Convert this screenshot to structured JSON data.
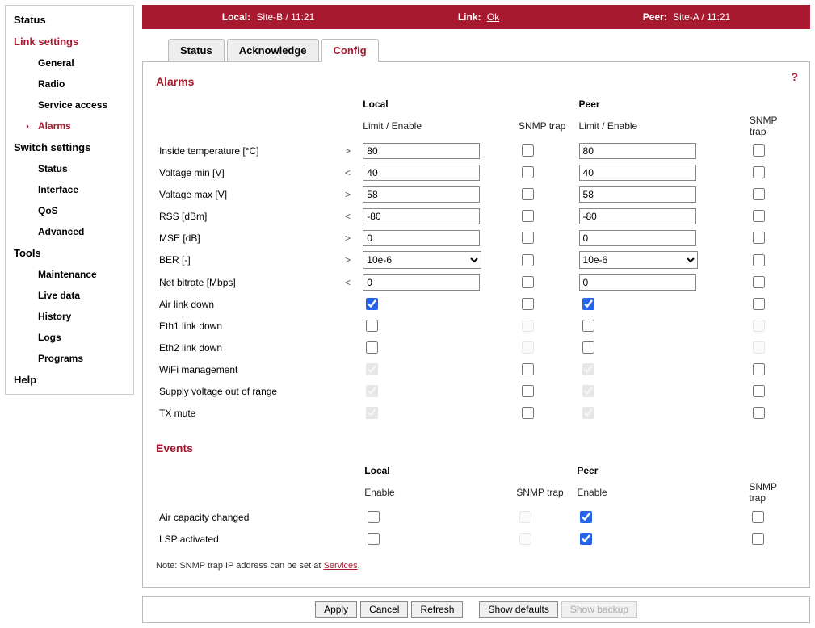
{
  "nav": {
    "sections": [
      {
        "label": "Status",
        "items": []
      },
      {
        "label": "Link settings",
        "active": true,
        "items": [
          {
            "label": "General"
          },
          {
            "label": "Radio"
          },
          {
            "label": "Service access"
          },
          {
            "label": "Alarms",
            "selected": true
          }
        ]
      },
      {
        "label": "Switch settings",
        "items": [
          {
            "label": "Status"
          },
          {
            "label": "Interface"
          },
          {
            "label": "QoS"
          },
          {
            "label": "Advanced"
          }
        ]
      },
      {
        "label": "Tools",
        "items": [
          {
            "label": "Maintenance"
          },
          {
            "label": "Live data"
          },
          {
            "label": "History"
          },
          {
            "label": "Logs"
          },
          {
            "label": "Programs"
          }
        ]
      },
      {
        "label": "Help",
        "items": []
      }
    ]
  },
  "topbar": {
    "localLabel": "Local:",
    "localValue": "Site-B / 11:21",
    "linkLabel": "Link:",
    "linkValue": "Ok",
    "peerLabel": "Peer:",
    "peerValue": "Site-A / 11:21"
  },
  "tabs": [
    {
      "label": "Status"
    },
    {
      "label": "Acknowledge"
    },
    {
      "label": "Config",
      "selected": true
    }
  ],
  "alarms": {
    "title": "Alarms",
    "headers": {
      "local": "Local",
      "peer": "Peer",
      "limitEnable": "Limit / Enable",
      "snmp": "SNMP trap"
    },
    "rows": [
      {
        "label": "Inside temperature [°C]",
        "op": ">",
        "type": "text",
        "local": "80",
        "peer": "80",
        "enL": false,
        "enP": false,
        "snL": false,
        "snP": false
      },
      {
        "label": "Voltage min [V]",
        "op": "<",
        "type": "text",
        "local": "40",
        "peer": "40",
        "enL": false,
        "enP": false,
        "snL": false,
        "snP": false
      },
      {
        "label": "Voltage max [V]",
        "op": ">",
        "type": "text",
        "local": "58",
        "peer": "58",
        "enL": false,
        "enP": false,
        "snL": false,
        "snP": false
      },
      {
        "label": "RSS [dBm]",
        "op": "<",
        "type": "text",
        "local": "-80",
        "peer": "-80",
        "enL": false,
        "enP": false,
        "snL": false,
        "snP": false
      },
      {
        "label": "MSE [dB]",
        "op": ">",
        "type": "text",
        "local": "0",
        "peer": "0",
        "enL": false,
        "enP": false,
        "snL": false,
        "snP": false
      },
      {
        "label": "BER [-]",
        "op": ">",
        "type": "select",
        "local": "10e-6",
        "peer": "10e-6",
        "enL": false,
        "enP": false,
        "snL": false,
        "snP": false
      },
      {
        "label": "Net bitrate [Mbps]",
        "op": "<",
        "type": "text",
        "local": "0",
        "peer": "0",
        "enL": false,
        "enP": false,
        "snL": false,
        "snP": false
      },
      {
        "label": "Air link down",
        "op": "",
        "type": "check",
        "enL": true,
        "enP": true,
        "snL": false,
        "snP": false
      },
      {
        "label": "Eth1 link down",
        "op": "",
        "type": "check",
        "enL": false,
        "enP": false,
        "snL": false,
        "snP": false,
        "snLdis": true,
        "snPdis": true
      },
      {
        "label": "Eth2 link down",
        "op": "",
        "type": "check",
        "enL": false,
        "enP": false,
        "snL": false,
        "snP": false,
        "snLdis": true,
        "snPdis": true
      },
      {
        "label": "WiFi management",
        "op": "",
        "type": "check",
        "enL": true,
        "enP": true,
        "enLdis": true,
        "enPdis": true,
        "snL": false,
        "snP": false
      },
      {
        "label": "Supply voltage out of range",
        "op": "",
        "type": "check",
        "enL": true,
        "enP": true,
        "enLdis": true,
        "enPdis": true,
        "snL": false,
        "snP": false
      },
      {
        "label": "TX mute",
        "op": "",
        "type": "check",
        "enL": true,
        "enP": true,
        "enLdis": true,
        "enPdis": true,
        "snL": false,
        "snP": false
      }
    ]
  },
  "events": {
    "title": "Events",
    "headers": {
      "local": "Local",
      "peer": "Peer",
      "enable": "Enable",
      "snmp": "SNMP trap"
    },
    "rows": [
      {
        "label": "Air capacity changed",
        "enL": false,
        "snL": false,
        "snLdis": true,
        "enP": true,
        "snP": false
      },
      {
        "label": "LSP activated",
        "enL": false,
        "snL": false,
        "snLdis": true,
        "enP": true,
        "snP": false
      }
    ]
  },
  "note": {
    "prefix": "Note: SNMP trap IP address can be set at ",
    "link": "Services",
    "suffix": "."
  },
  "helpIcon": "?",
  "actions": {
    "apply": "Apply",
    "cancel": "Cancel",
    "refresh": "Refresh",
    "defaults": "Show defaults",
    "backup": "Show backup"
  }
}
